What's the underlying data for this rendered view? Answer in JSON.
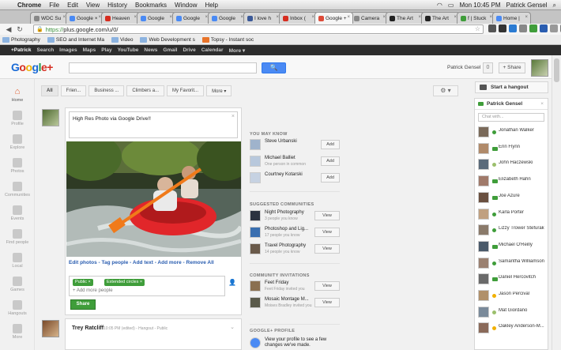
{
  "os_menubar": {
    "app": "Chrome",
    "menus": [
      "File",
      "Edit",
      "View",
      "History",
      "Bookmarks",
      "Window",
      "Help"
    ],
    "clock": "Mon 10:45 PM",
    "user": "Patrick Gensel"
  },
  "tabs": [
    {
      "label": "WDC Su",
      "color": "#888"
    },
    {
      "label": "Google ×",
      "color": "#4a8af4"
    },
    {
      "label": "Heaven",
      "color": "#d62d20"
    },
    {
      "label": "Google",
      "color": "#4a8af4"
    },
    {
      "label": "Google",
      "color": "#4a8af4"
    },
    {
      "label": "Google",
      "color": "#4a8af4"
    },
    {
      "label": "I love h",
      "color": "#3b5998"
    },
    {
      "label": "Inbox (",
      "color": "#d62d20"
    },
    {
      "label": "Google +",
      "color": "#dd4b39",
      "active": true
    },
    {
      "label": "Camera",
      "color": "#888"
    },
    {
      "label": "The Art",
      "color": "#222"
    },
    {
      "label": "The Art",
      "color": "#222"
    },
    {
      "label": "f | Stuck",
      "color": "#3f9d3a"
    },
    {
      "label": "Home |",
      "color": "#4a8af4"
    }
  ],
  "url": {
    "scheme": "https://",
    "rest": "plus.google.com/u/0/"
  },
  "bookmarks": [
    "Photography",
    "SEO and Internet Ma",
    "Video",
    "Web Development s",
    "Topsy - Instant soc"
  ],
  "gbar": {
    "me": "+Patrick",
    "items": [
      "Search",
      "Images",
      "Maps",
      "Play",
      "YouTube",
      "News",
      "Gmail",
      "Drive",
      "Calendar",
      "More ▾"
    ]
  },
  "header": {
    "logo": {
      "g": "G",
      "o1": "o",
      "o2": "o",
      "g2": "g",
      "l": "l",
      "e": "e",
      "plus": "+"
    },
    "search_button": "🔍",
    "username": "Patrick Gensel",
    "notifications": "0",
    "share": "+ Share"
  },
  "leftnav": [
    {
      "label": "Home",
      "active": true,
      "glyph": "⌂"
    },
    {
      "label": "Profile"
    },
    {
      "label": "Explore"
    },
    {
      "label": "Photos"
    },
    {
      "label": "Communities"
    },
    {
      "label": "Events"
    },
    {
      "label": "Find people"
    },
    {
      "label": "Local"
    },
    {
      "label": "Games"
    },
    {
      "label": "Hangouts"
    },
    {
      "label": "More"
    }
  ],
  "filters": [
    "All",
    "Frien...",
    "Business ...",
    "Climbers a...",
    "My Favorit...",
    "More ▾"
  ],
  "composer": {
    "text": "High Res Photo via Google Drive!!",
    "edit_links": "Edit photos - Tag people - Add text - Add more - Remove All",
    "circle_public": "Public ×",
    "circle_extended": "Extended circles ×",
    "add_more": "+ Add more people",
    "share_button": "Share"
  },
  "post2": {
    "name": "Trey Ratcliff",
    "meta": "10:05 PM (edited) - Hangout - Public"
  },
  "you_may_know": {
    "heading": "YOU MAY KNOW",
    "people": [
      {
        "name": "Steve Urbanski",
        "sub": "",
        "btn": "Add"
      },
      {
        "name": "Michael Balliet",
        "sub": "One person in common",
        "btn": "Add"
      },
      {
        "name": "Courtney Kotarski",
        "sub": "",
        "btn": "Add"
      }
    ]
  },
  "suggested": {
    "heading": "SUGGESTED COMMUNITIES",
    "items": [
      {
        "name": "Night Photography",
        "sub": "3 people you know",
        "btn": "View"
      },
      {
        "name": "Photoshop and Lig...",
        "sub": "17 people you know",
        "btn": "View"
      },
      {
        "name": "Travel Photography",
        "sub": "14 people you know",
        "btn": "View"
      }
    ]
  },
  "invitations": {
    "heading": "COMMUNITY INVITATIONS",
    "items": [
      {
        "name": "Feet Friday",
        "sub": "Feet Friday invited you",
        "btn": "View"
      },
      {
        "name": "Mosaic Montage M...",
        "sub": "Moises Bradley invited you",
        "btn": "View"
      }
    ]
  },
  "profile_box": {
    "heading": "GOOGLE+ PROFILE",
    "line1": "View your profile to see a few",
    "line2": "changes we've made."
  },
  "hangout": {
    "label": "Start a hangout"
  },
  "chat": {
    "owner": "Patrick Gensel",
    "search_placeholder": "Chat with...",
    "contacts": [
      {
        "name": "Jonathan Walker",
        "status": "online"
      },
      {
        "name": "Erin Flynn",
        "status": "video"
      },
      {
        "name": "John Haczewski",
        "status": "idle"
      },
      {
        "name": "Elizabeth Hahn",
        "status": "video"
      },
      {
        "name": "Joe Azure",
        "status": "video"
      },
      {
        "name": "Karla Porter",
        "status": "online"
      },
      {
        "name": "Lizzy Trower Stefurak",
        "status": "online"
      },
      {
        "name": "Michael O'Reilly",
        "status": "video"
      },
      {
        "name": "Samantha Williamson",
        "status": "online"
      },
      {
        "name": "Daniel Hercovitch",
        "status": "video"
      },
      {
        "name": "Jason Percival",
        "status": "away"
      },
      {
        "name": "Mat Giordano",
        "status": "idle"
      },
      {
        "name": "Oakley Anderson-M...",
        "status": "away"
      }
    ]
  },
  "colors": {
    "online": "#3f9d3a",
    "video": "#3f9d3a",
    "idle": "#9bbf6c",
    "away": "#f1b000",
    "link": "#2a5db0",
    "accent": "#4a8af4"
  }
}
